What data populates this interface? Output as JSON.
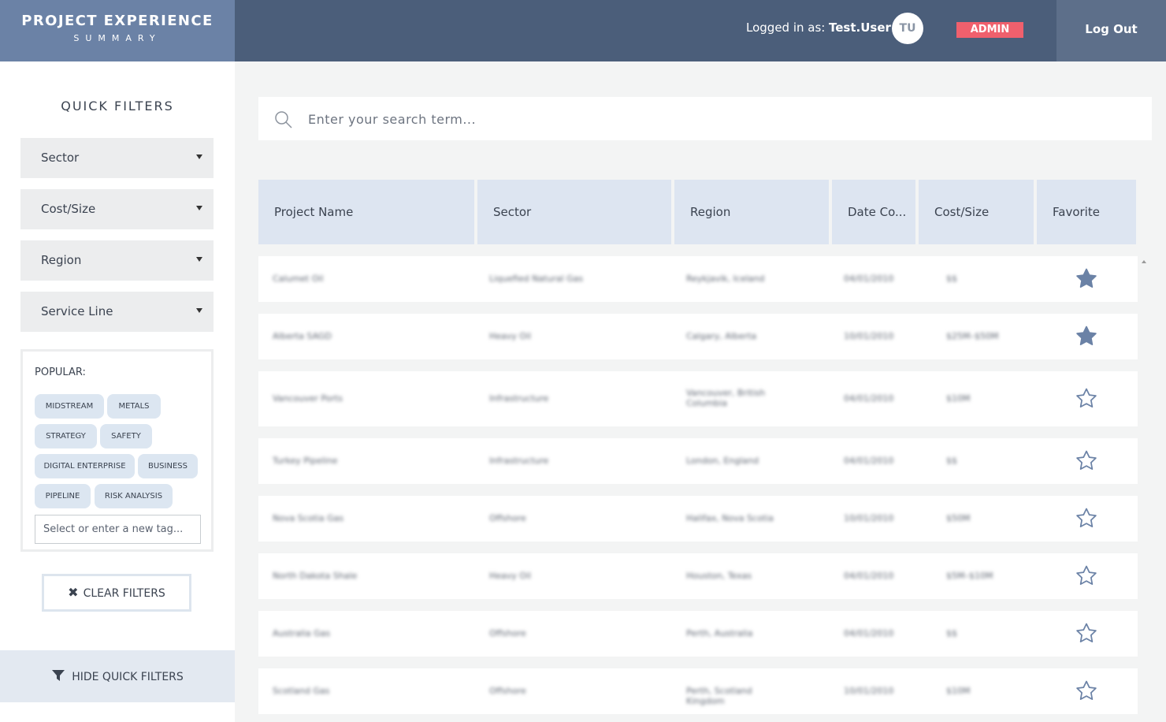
{
  "header": {
    "title": "PROJECT EXPERIENCE",
    "subtitle": "SUMMARY",
    "logged_in_label": "Logged in as:",
    "username": "Test.User",
    "avatar_initials": "TU",
    "role_badge": "ADMIN",
    "logout_label": "Log Out"
  },
  "sidebar": {
    "title": "QUICK FILTERS",
    "filters": [
      "Sector",
      "Cost/Size",
      "Region",
      "Service Line"
    ],
    "popular_label": "POPULAR:",
    "tags": [
      "MIDSTREAM",
      "METALS",
      "STRATEGY",
      "SAFETY",
      "DIGITAL ENTERPRISE",
      "BUSINESS",
      "PIPELINE",
      "RISK ANALYSIS"
    ],
    "tag_placeholder": "Select or enter a new tag...",
    "clear_label": "CLEAR FILTERS",
    "hide_label": "HIDE QUICK FILTERS"
  },
  "search": {
    "placeholder": "Enter your search term..."
  },
  "table": {
    "columns": [
      "Project Name",
      "Sector",
      "Region",
      "Date Co...",
      "Cost/Size",
      "Favorite"
    ],
    "rows": [
      {
        "name": "Calumet Oil",
        "sector": "Liquefied Natural Gas",
        "region": "Reykjavik, Iceland",
        "date": "04/01/2010",
        "cost": "$$",
        "favorite": true
      },
      {
        "name": "Alberta SAGD",
        "sector": "Heavy Oil",
        "region": "Calgary, Alberta",
        "date": "10/01/2010",
        "cost": "$25M–$50M",
        "favorite": true
      },
      {
        "name": "Vancouver Ports",
        "sector": "Infrastructure",
        "region": "Vancouver, British Columbia",
        "date": "04/01/2010",
        "cost": "$10M",
        "favorite": false
      },
      {
        "name": "Turkey Pipeline",
        "sector": "Infrastructure",
        "region": "London, England",
        "date": "04/01/2010",
        "cost": "$$",
        "favorite": false
      },
      {
        "name": "Nova Scotia Gas",
        "sector": "Offshore",
        "region": "Halifax, Nova Scotia",
        "date": "10/01/2010",
        "cost": "$50M",
        "favorite": false
      },
      {
        "name": "North Dakota Shale",
        "sector": "Heavy Oil",
        "region": "Houston, Texas",
        "date": "04/01/2010",
        "cost": "$5M–$10M",
        "favorite": false
      },
      {
        "name": "Australia Gas",
        "sector": "Offshore",
        "region": "Perth, Australia",
        "date": "04/01/2010",
        "cost": "$$",
        "favorite": false
      },
      {
        "name": "Scotland Gas",
        "sector": "Offshore",
        "region": "Perth, Scotland Kingdom",
        "date": "10/01/2010",
        "cost": "$10M",
        "favorite": false
      }
    ]
  },
  "colors": {
    "header_bg": "#4b5e7a",
    "brand_bg": "#6b82a6",
    "admin_badge": "#f0606d",
    "table_header_bg": "#dde5f1",
    "tag_bg": "#dce6f1",
    "star_filled": "#6b82a6"
  },
  "icons": {
    "search": "search-icon",
    "dropdown": "caret-down-icon",
    "clear": "close-icon",
    "hide": "funnel-icon",
    "favorite_on": "star-filled-icon",
    "favorite_off": "star-outline-icon"
  }
}
